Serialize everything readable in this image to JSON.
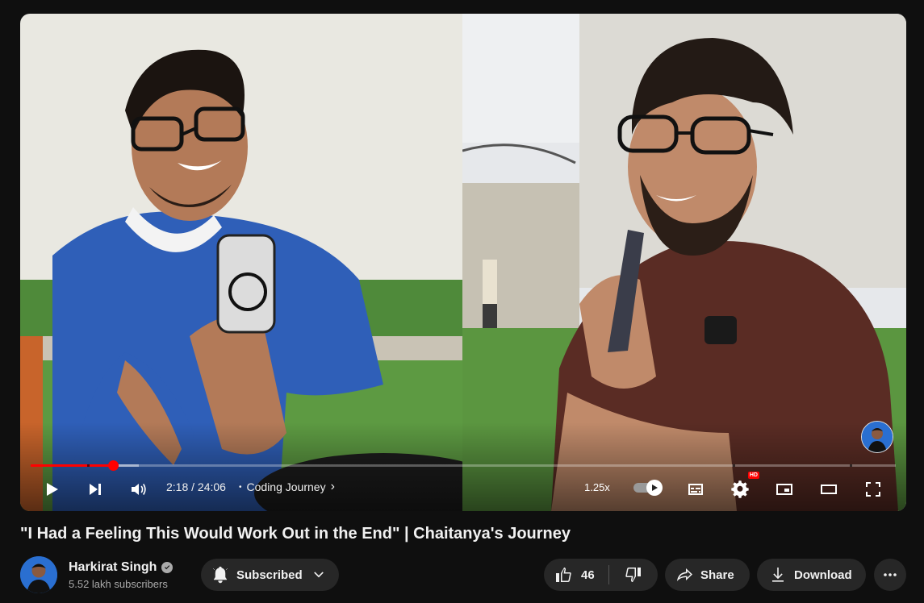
{
  "player": {
    "current_time": "2:18",
    "separator": "/",
    "duration": "24:06",
    "chapter_dot": "•",
    "chapter": "Coding Journey",
    "chapter_chevron": "›",
    "speed": "1.25x",
    "played_fraction": 0.095,
    "buffered_fraction": 0.125,
    "hd_badge": "HD",
    "accent_color": "#ff0000"
  },
  "video": {
    "title": "\"I Had a Feeling This Would Work Out in the End\" | Chaitanya's Journey"
  },
  "channel": {
    "name": "Harkirat Singh",
    "subscribers": "5.52 lakh subscribers"
  },
  "actions": {
    "subscribe_label": "Subscribed",
    "like_count": "46",
    "share_label": "Share",
    "download_label": "Download"
  },
  "icons": {
    "play": "play-icon",
    "next": "next-icon",
    "volume": "volume-icon",
    "autoplay": "autoplay-toggle",
    "subtitles": "subtitles-icon",
    "settings": "settings-icon",
    "miniplayer": "miniplayer-icon",
    "theater": "theater-icon",
    "fullscreen": "fullscreen-icon",
    "bell": "bell-icon",
    "like": "like-icon",
    "dislike": "dislike-icon",
    "share": "share-icon",
    "download": "download-icon",
    "more": "more-icon"
  }
}
